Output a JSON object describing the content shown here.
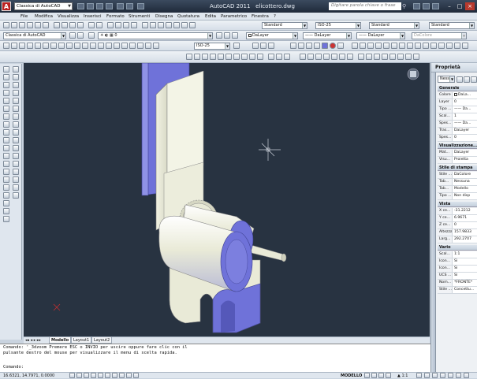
{
  "title_bar": {
    "workspace": "Classica di AutoCAD",
    "app_title": "AutoCAD 2011",
    "file_name": "elicottero.dwg",
    "help_search_placeholder": "Digitare parola chiave o frase"
  },
  "menu": {
    "items": [
      "File",
      "Modifica",
      "Visualizza",
      "Inserisci",
      "Formato",
      "Strumenti",
      "Disegna",
      "Quotatura",
      "Edita",
      "Parametrico",
      "Finestra",
      "?"
    ]
  },
  "toolbars": {
    "workspace_combo": "Classica di AutoCAD",
    "text_style_1": "Standard",
    "dim_style": "ISO-25",
    "table_style": "Standard",
    "multileader_style": "Standard",
    "layer_combo": "0",
    "color_combo": "DaLayer",
    "linetype_combo": "DaLayer",
    "lineweight_combo": "DaLayer",
    "plotstyle_combo": "DaColore",
    "dim_style_2": "ISO-25"
  },
  "tabs": {
    "items": [
      "Modello",
      "Layout1",
      "Layout2"
    ]
  },
  "command": {
    "line1": "Comando: '_3dzoom Premere ESC o INVIO per uscire oppure fare clic con il",
    "line2": "pulsante destro del mouse per visualizzare il menu di scelta rapida.",
    "prompt": "Comando:"
  },
  "status": {
    "coords": "16.6321, 14.7971, 0.0000",
    "model": "MODELLO",
    "scale": "1:1"
  },
  "properties": {
    "title": "Proprietà",
    "selector": "Nessu",
    "sections": [
      {
        "name": "Generale",
        "rows": [
          {
            "k": "Colore",
            "v": "DaLa...",
            "swatch": true
          },
          {
            "k": "Layer",
            "v": "0"
          },
          {
            "k": "Tipo ...",
            "v": "—— Da..."
          },
          {
            "k": "Scal...",
            "v": "1"
          },
          {
            "k": "Spes...",
            "v": "—— Da..."
          },
          {
            "k": "Tras...",
            "v": "DaLayer"
          },
          {
            "k": "Spes...",
            "v": "0"
          }
        ]
      },
      {
        "name": "Visualizzazione...",
        "rows": [
          {
            "k": "Mat...",
            "v": "DaLayer"
          },
          {
            "k": "Visu...",
            "v": "Proietta"
          }
        ]
      },
      {
        "name": "Stile di stampa",
        "rows": [
          {
            "k": "Stile ...",
            "v": "DaColore"
          },
          {
            "k": "Tab...",
            "v": "Nessuna"
          },
          {
            "k": "Tab...",
            "v": "Modello"
          },
          {
            "k": "Tipo ...",
            "v": "Non disp"
          }
        ]
      },
      {
        "name": "Vista",
        "rows": [
          {
            "k": "X ce...",
            "v": "-31.2212"
          },
          {
            "k": "Y ce...",
            "v": "6.9671"
          },
          {
            "k": "Z ce...",
            "v": "0"
          },
          {
            "k": "Altezza",
            "v": "157.9833"
          },
          {
            "k": "Larg...",
            "v": "292.2707"
          }
        ]
      },
      {
        "name": "Vario",
        "rows": [
          {
            "k": "Scal...",
            "v": "1:1"
          },
          {
            "k": "Icon...",
            "v": "Sì"
          },
          {
            "k": "Icon...",
            "v": "Sì"
          },
          {
            "k": "UCS ...",
            "v": "Sì"
          },
          {
            "k": "Nom...",
            "v": "*FRONTE*"
          },
          {
            "k": "Stile ...",
            "v": "Concettu..."
          }
        ]
      }
    ]
  },
  "colors": {
    "viewport_bg": "#283341",
    "solid_light": "#e9ead7",
    "solid_blue": "#6f72d9"
  }
}
